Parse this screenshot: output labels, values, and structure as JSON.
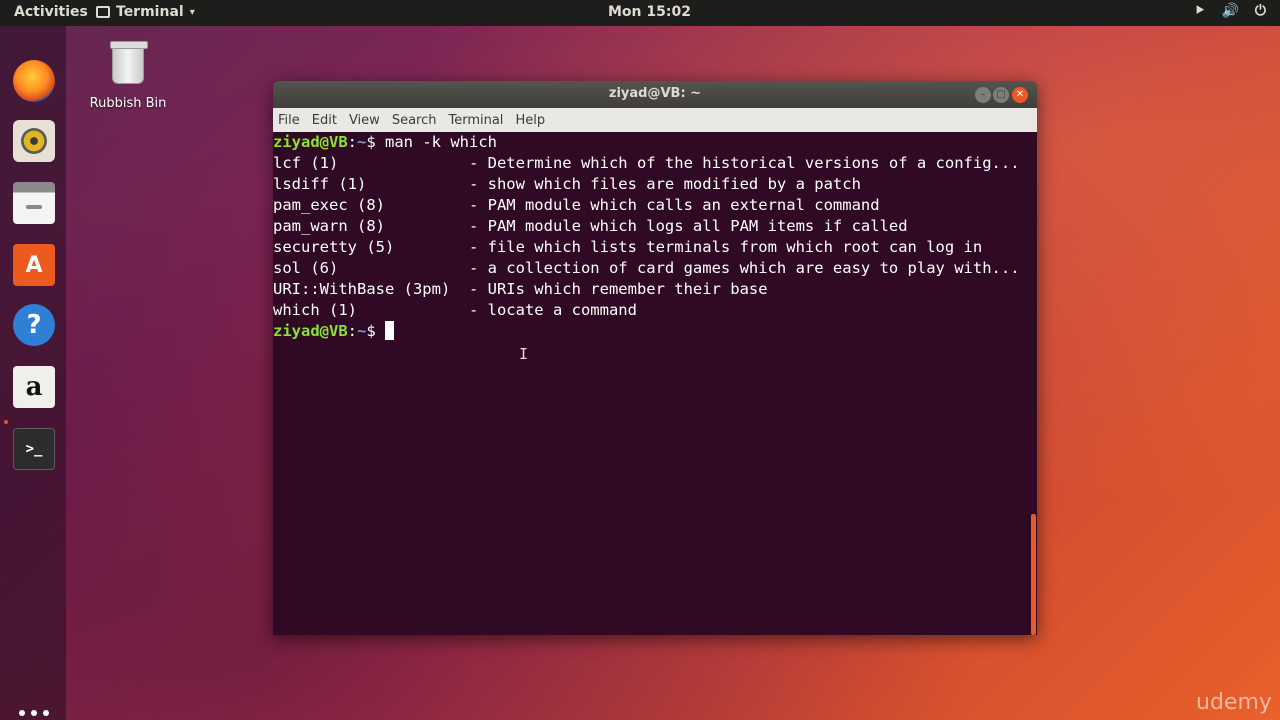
{
  "top_bar": {
    "activities": "Activities",
    "app_name": "Terminal",
    "caret": "▾",
    "clock": "Mon 15:02",
    "network_icon": "⯈",
    "volume_icon": "🔊",
    "power_icon": "⏻"
  },
  "desktop": {
    "trash_label": "Rubbish Bin",
    "watermark": "udemy"
  },
  "dock": {
    "items": [
      "firefox-icon",
      "rhythmbox-icon",
      "files-icon",
      "software-icon",
      "help-icon",
      "amazon-icon",
      "terminal-icon",
      "show-apps-icon"
    ],
    "software_glyph": "A",
    "help_glyph": "?",
    "amazon_glyph": "a",
    "terminal_glyph": ">_"
  },
  "window": {
    "title": "ziyad@VB: ~",
    "min_glyph": "–",
    "max_glyph": "□",
    "close_glyph": "✕",
    "menu": [
      "File",
      "Edit",
      "View",
      "Search",
      "Terminal",
      "Help"
    ]
  },
  "terminal": {
    "prompt_user": "ziyad@VB",
    "prompt_sep": ":",
    "prompt_path": "~",
    "prompt_dollar": "$ ",
    "command": "man -k which",
    "output": [
      "lcf (1)              - Determine which of the historical versions of a config...",
      "lsdiff (1)           - show which files are modified by a patch",
      "pam_exec (8)         - PAM module which calls an external command",
      "pam_warn (8)         - PAM module which logs all PAM items if called",
      "securetty (5)        - file which lists terminals from which root can log in",
      "sol (6)              - a collection of card games which are easy to play with...",
      "URI::WithBase (3pm)  - URIs which remember their base",
      "which (1)            - locate a command"
    ],
    "ibeam": "I"
  }
}
